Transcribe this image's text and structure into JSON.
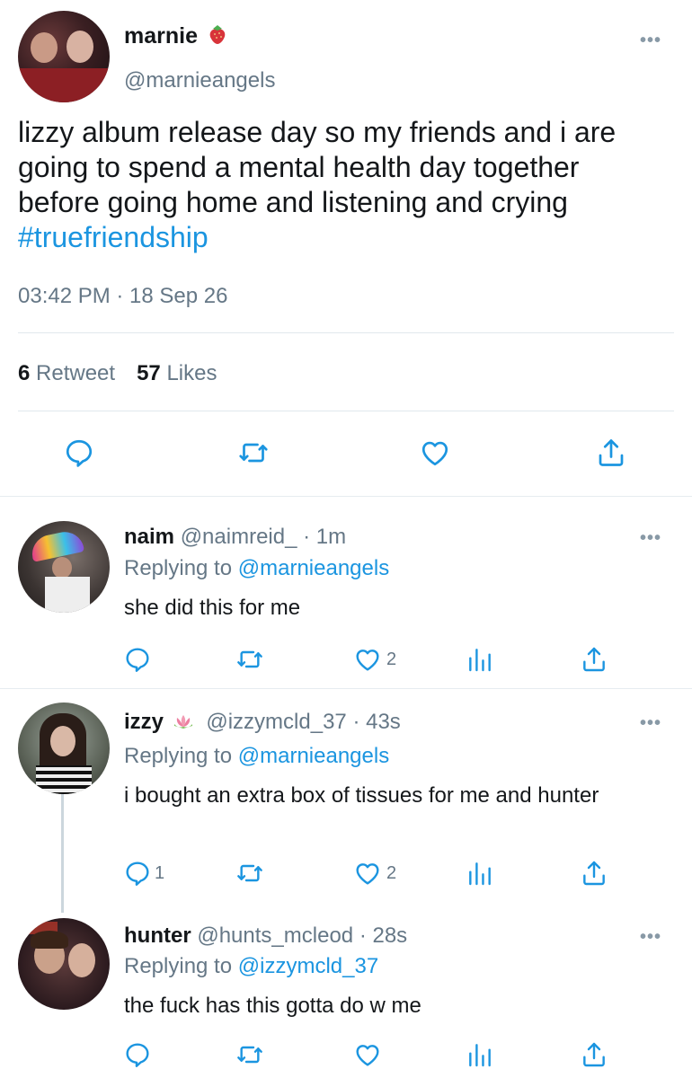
{
  "main_tweet": {
    "name": "marnie",
    "name_emoji": "strawberry",
    "handle": "@marnieangels",
    "text_lines": [
      "lizzy album release day so my friends and i are",
      "going to spend a mental health day together",
      "before going home and listening and crying"
    ],
    "hashtag": "#truefriendship",
    "timestamp": "03:42 PM · 18 Sep 26",
    "retweets_count": "6",
    "retweets_label": "Retweet",
    "likes_count": "57",
    "likes_label": "Likes",
    "actions": [
      "reply-icon",
      "retweet-icon",
      "heart-icon",
      "share-icon"
    ]
  },
  "replies": [
    {
      "name": "naim",
      "handle": "@naimreid_",
      "time": "· 1m",
      "replying_prefix": "Replying to",
      "replying_to": "@marnieangels",
      "text": "she did this for me",
      "reply_count": "",
      "like_count": "2"
    },
    {
      "name": "izzy",
      "name_emoji": "lotus",
      "handle": "@izzymcld_37",
      "time": "· 43s",
      "replying_prefix": "Replying to",
      "replying_to": "@marnieangels",
      "text": "i bought an extra box of tissues for me and hunter",
      "reply_count": "1",
      "like_count": "2"
    },
    {
      "name": "hunter",
      "handle": "@hunts_mcleod",
      "time": "· 28s",
      "replying_prefix": "Replying to",
      "replying_to": "@izzymcld_37",
      "text": "the fuck has this gotta do w me",
      "reply_count": "",
      "like_count": ""
    }
  ],
  "more_glyph": "•••",
  "colors": {
    "link": "#1b95e0",
    "secondary": "#657786",
    "icon": "#1b95e0",
    "divider": "#e1e8ed"
  }
}
